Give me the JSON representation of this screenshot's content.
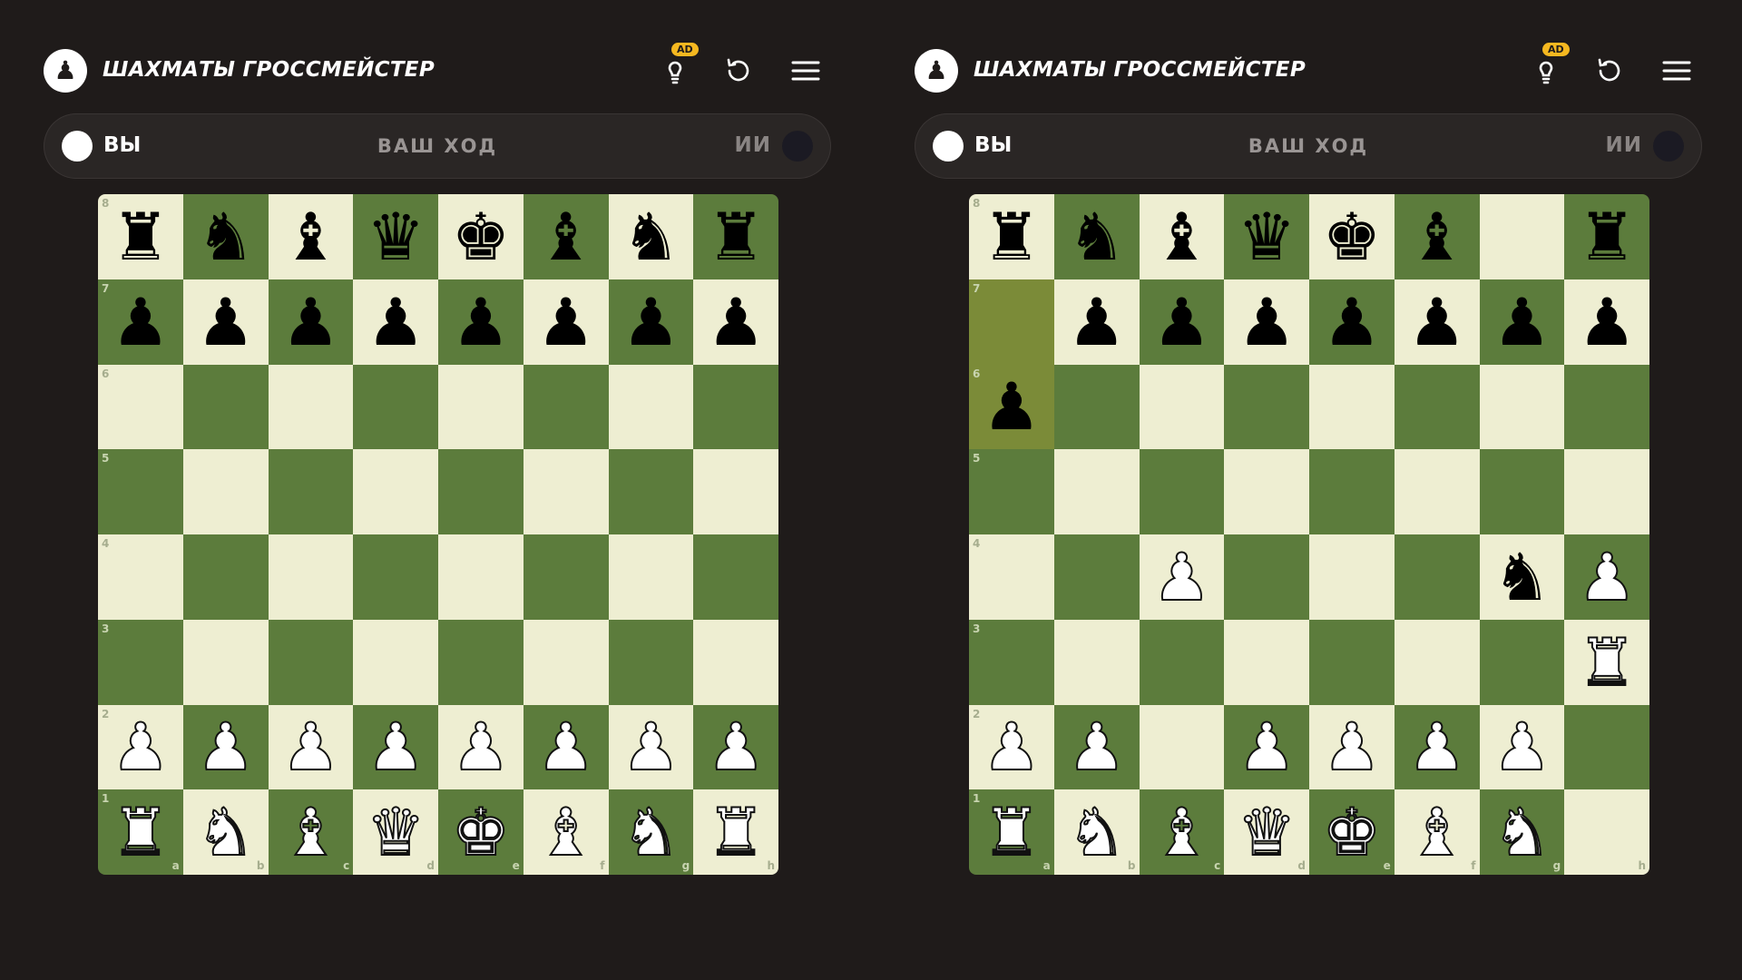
{
  "colors": {
    "background": "#1f1b1a",
    "light_square": "#eeeed2",
    "dark_square": "#5c7c3c",
    "highlight": "#7b8b38",
    "ad_badge": "#f5b820"
  },
  "panels": [
    {
      "app_title": "ШАХМАТЫ ГРОССМЕЙСТЕР",
      "ad_badge": "AD",
      "icons": {
        "logo": "pawn-icon",
        "hint": "lightbulb-icon",
        "restart": "restart-icon",
        "menu": "hamburger-menu-icon"
      },
      "status": {
        "you": "ВЫ",
        "turn": "ВАШ ХОД",
        "ai": "ИИ"
      },
      "highlight": [],
      "board": [
        "rnbqkbnr",
        "pppppppp",
        "........",
        "........",
        "........",
        "........",
        "PPPPPPPP",
        "RNBQKBNR"
      ]
    },
    {
      "app_title": "ШАХМАТЫ ГРОССМЕЙСТЕР",
      "ad_badge": "AD",
      "icons": {
        "logo": "pawn-icon",
        "hint": "lightbulb-icon",
        "restart": "restart-icon",
        "menu": "hamburger-menu-icon"
      },
      "status": {
        "you": "ВЫ",
        "turn": "ВАШ ХОД",
        "ai": "ИИ"
      },
      "highlight": [
        "a7",
        "a6"
      ],
      "board": [
        "rnbqkb.r",
        ".ppppppp",
        "p.......",
        "........",
        "..P...nP",
        ".......R",
        "PP.PPPP.",
        "RNBQKBN."
      ]
    }
  ],
  "ranks": [
    "8",
    "7",
    "6",
    "5",
    "4",
    "3",
    "2",
    "1"
  ],
  "files": [
    "a",
    "b",
    "c",
    "d",
    "e",
    "f",
    "g",
    "h"
  ]
}
